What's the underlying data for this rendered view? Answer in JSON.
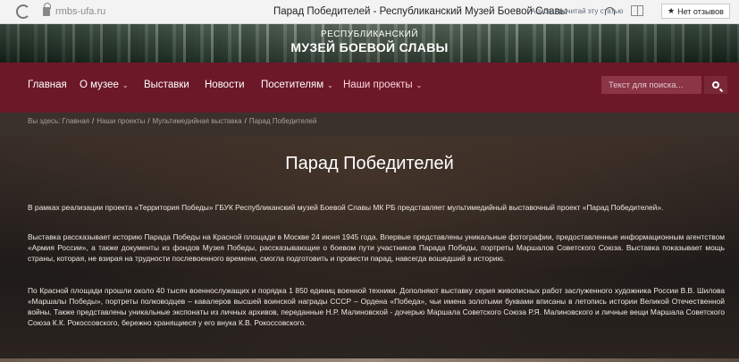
{
  "browser": {
    "url": "rmbs-ufa.ru",
    "page_title": "Парад Победителей - Республиканский Музей Боевой Славы",
    "listen_hint": "Алиса, прочитай эту статью",
    "reviews_label": "Нет отзывов"
  },
  "banner": {
    "line1": "РЕСПУБЛИКАНСКИЙ",
    "line2": "МУЗЕЙ БОЕВОЙ СЛАВЫ"
  },
  "nav": {
    "items": [
      {
        "label": "Главная"
      },
      {
        "label": "О музее"
      },
      {
        "label": "Выставки"
      },
      {
        "label": "Новости"
      },
      {
        "label": "Посетителям"
      },
      {
        "label": "Наши проекты"
      }
    ],
    "search_placeholder": "Текст для поиска..."
  },
  "breadcrumb": {
    "prefix": "Вы здесь:",
    "items": [
      "Главная",
      "Наши проекты",
      "Мультимедийная выставка",
      "Парад Победителей"
    ]
  },
  "article": {
    "title": "Парад Победителей",
    "paragraphs": [
      "В рамках реализации проекта «Территория Победы» ГБУК Республиканский музей Боевой Славы МК РБ представляет мультимедийный выставочный проект «Парад Победителей».",
      "Выставка рассказывает историю Парада Победы на Красной площади в Москве 24 июня 1945 года. Впервые представлены уникальные фотографии, предоставленные информационным агентством «Армия России», а также документы из фондов Музея Победы, рассказывающие о боевом пути участников Парада Победы, портреты Маршалов Советского Союза. Выставка показывает мощь страны, которая, не взирая на трудности послевоенного времени, смогла подготовить и провести парад, навсегда вошедший в историю.",
      "По Красной площади прошли около 40 тысяч военнослужащих и порядка 1 850 единиц военной техники. Дополняют выставку серия живописных работ заслуженного художника России В.В. Шилова «Маршалы Победы», портреты полководцев – кавалеров высшей воинской награды СССР – Ордена «Победа», чьи имена золотыми буквами вписаны в летопись истории Великой Отечественной войны. Также представлены уникальные экспонаты из личных архивов, переданные Н.Р. Малиновской - дочерью Маршала Советского Союза Р.Я. Малиновского и личные вещи Маршала Советского Союза К.К. Рокоссовского, бережно хранящиеся у его внука К.В. Рокоссовского."
    ]
  },
  "colors": {
    "nav_bg": "#6c1828",
    "search_bg": "#8b3546",
    "page_bg": "#2a2522"
  },
  "icons": [
    "reload-icon",
    "lock-icon",
    "headphones-icon",
    "reader-mode-icon",
    "star-icon",
    "chevron-down-icon",
    "search-icon"
  ]
}
